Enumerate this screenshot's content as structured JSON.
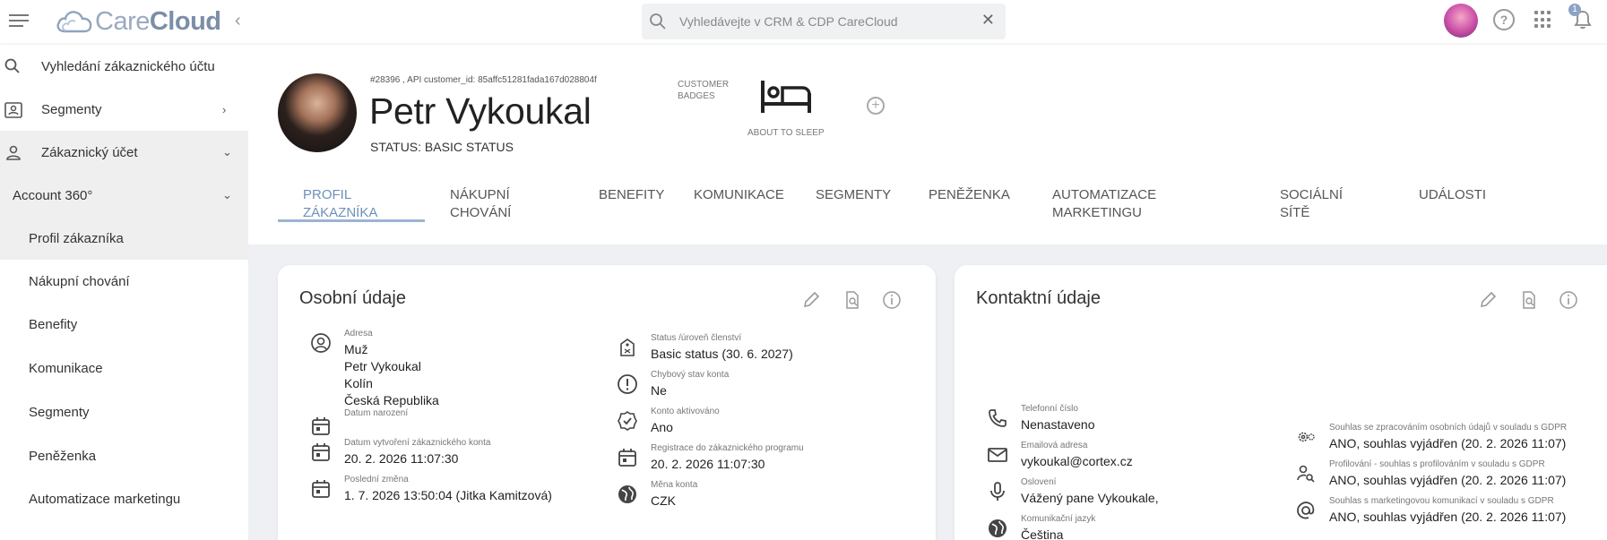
{
  "app": {
    "brand_light": "Care",
    "brand_bold": "Cloud",
    "search_placeholder": "Vyhledávejte v CRM & CDP CareCloud",
    "notification_count": "1",
    "accent_color": "#9cb4d2"
  },
  "sidebar": {
    "items": [
      {
        "label": "Vyhledání zákaznického účtu"
      },
      {
        "label": "Segmenty"
      },
      {
        "label": "Zákaznický účet"
      },
      {
        "label": "Account 360°"
      },
      {
        "label": "Profil zákazníka"
      },
      {
        "label": "Nákupní chování"
      },
      {
        "label": "Benefity"
      },
      {
        "label": "Komunikace"
      },
      {
        "label": "Segmenty"
      },
      {
        "label": "Peněženka"
      },
      {
        "label": "Automatizace marketingu"
      }
    ]
  },
  "customer": {
    "id_line": "#28396 , API customer_id: 85affc51281fada167d028804f",
    "name": "Petr Vykoukal",
    "status": "STATUS: BASIC STATUS",
    "badges_label_1": "CUSTOMER",
    "badges_label_2": "BADGES",
    "badge_name": "ABOUT TO SLEEP"
  },
  "tabs": [
    {
      "label": "PROFIL ZÁKAZNÍKA"
    },
    {
      "label": "NÁKUPNÍ CHOVÁNÍ"
    },
    {
      "label": "BENEFITY"
    },
    {
      "label": "KOMUNIKACE"
    },
    {
      "label": "SEGMENTY"
    },
    {
      "label": "PENĚŽENKA"
    },
    {
      "label": "AUTOMATIZACE MARKETINGU"
    },
    {
      "label": "SOCIÁLNÍ SÍTĚ"
    },
    {
      "label": "UDÁLOSTI"
    }
  ],
  "personal": {
    "title": "Osobní údaje",
    "address_label": "Adresa",
    "address_lines": [
      "Muž",
      "Petr Vykoukal",
      "Kolín",
      "Česká Republika"
    ],
    "birth_label": "Datum narození",
    "created_label": "Datum vytvoření zákaznického konta",
    "created_value": "20. 2. 2026 11:07:30",
    "changed_label": "Poslední změna",
    "changed_value": "1. 7. 2026 13:50:04 (Jitka Kamitzová)",
    "membership_label": "Status /úroveň členství",
    "membership_value": "Basic status (30. 6. 2027)",
    "error_label": "Chybový stav konta",
    "error_value": "Ne",
    "activated_label": "Konto aktivováno",
    "activated_value": "Ano",
    "registration_label": "Registrace do zákaznického programu",
    "registration_value": "20. 2. 2026 11:07:30",
    "currency_label": "Měna konta",
    "currency_value": "CZK"
  },
  "contact": {
    "title": "Kontaktní údaje",
    "phone_label": "Telefonní číslo",
    "phone_value": "Nenastaveno",
    "email_label": "Emailová adresa",
    "email_value": "vykoukal@cortex.cz",
    "salutation_label": "Oslovení",
    "salutation_value": "Vážený pane Vykoukale,",
    "language_label": "Komunikační jazyk",
    "language_value": "Čeština",
    "gdpr1_label": "Souhlas se zpracováním osobních údajů v souladu s GDPR",
    "gdpr1_value": "ANO, souhlas vyjádřen (20. 2. 2026 11:07)",
    "gdpr2_label": "Profilování - souhlas s profilováním v souladu s GDPR",
    "gdpr2_value": "ANO, souhlas vyjádřen (20. 2. 2026 11:07)",
    "gdpr3_label": "Souhlas s marketingovou komunikací v souladu s GDPR",
    "gdpr3_value": "ANO, souhlas vyjádřen (20. 2. 2026 11:07)"
  }
}
